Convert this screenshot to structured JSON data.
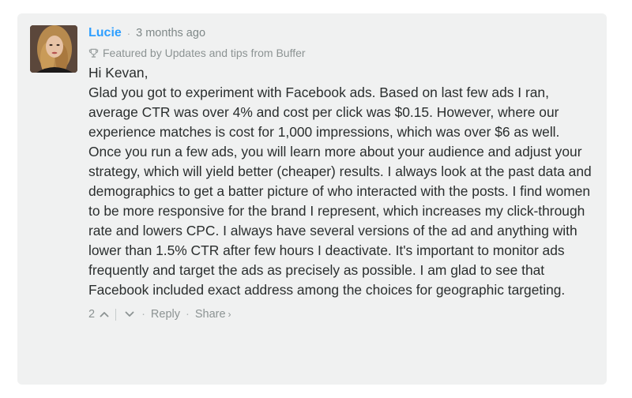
{
  "comment": {
    "author": "Lucie",
    "separator": "·",
    "timestamp": "3 months ago",
    "featured_text": "Featured by Updates and tips from Buffer",
    "paragraphs": [
      "Hi Kevan,",
      "Glad you got to experiment with Facebook ads. Based on last few ads I ran, average CTR was over 4% and cost per click was $0.15. However, where our experience matches is cost for 1,000 impressions, which was over $6 as well.",
      "Once you run a few ads, you will learn more about your audience and adjust your strategy, which will yield better (cheaper) results. I always look at the past data and demographics to get a batter picture of who interacted with the posts. I find women to be more responsive for the brand I represent, which increases my click-through rate and lowers CPC. I always have several versions of the ad and anything with lower than 1.5% CTR after few hours I deactivate. It's important to monitor ads frequently and target the ads as precisely as possible. I am glad to see that Facebook included exact address among the choices for geographic targeting."
    ],
    "footer": {
      "vote_count": "2",
      "dot": "·",
      "reply_label": "Reply",
      "share_label": "Share",
      "share_arrow": "›"
    }
  },
  "icons": {
    "upvote": "chevron-up-icon",
    "downvote": "chevron-down-icon",
    "featured": "trophy-icon"
  },
  "colors": {
    "author": "#2e9fff",
    "card_background": "#f0f1f1",
    "body_text": "#2a2e2e",
    "muted_text": "#8c9393"
  }
}
